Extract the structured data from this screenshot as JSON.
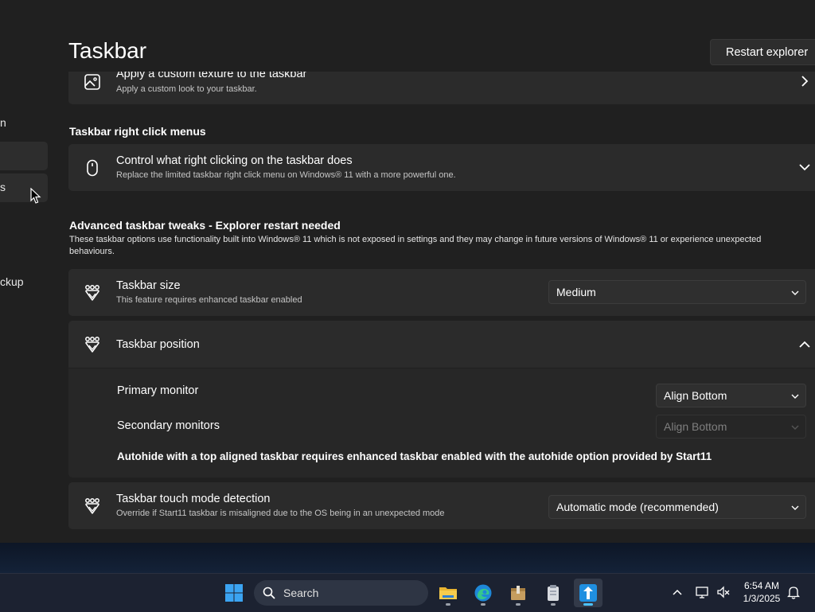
{
  "window": {
    "minimize_glyph": "—",
    "maximize_glyph": "▢"
  },
  "header": {
    "page_title": "Taskbar",
    "restart_button": "Restart explorer"
  },
  "sidebar": {
    "items": [
      {
        "label": "n"
      },
      {
        "label": ""
      },
      {
        "label": "s"
      },
      {
        "label": "ckup"
      }
    ]
  },
  "texture_card": {
    "title": "Apply a custom texture to the taskbar",
    "desc": "Apply a custom look to your taskbar."
  },
  "right_click_section": {
    "title": "Taskbar right click menus",
    "card": {
      "title": "Control what right clicking on the taskbar does",
      "desc": "Replace the limited taskbar right click menu on Windows® 11 with a more powerful one."
    }
  },
  "advanced_section": {
    "title": "Advanced taskbar tweaks - Explorer restart needed",
    "desc_line1": "These taskbar options use functionality built into Windows® 11 which is not exposed in settings and they may change in future versions of Windows® 11 or experience unexpected",
    "desc_line2": "behaviours."
  },
  "taskbar_size": {
    "title": "Taskbar size",
    "desc": "This feature requires enhanced taskbar enabled",
    "value": "Medium"
  },
  "taskbar_position": {
    "title": "Taskbar position",
    "primary_label": "Primary monitor",
    "primary_value": "Align Bottom",
    "secondary_label": "Secondary monitors",
    "secondary_value": "Align Bottom",
    "note": "Autohide with a top aligned taskbar requires enhanced taskbar enabled with the autohide option provided by Start11"
  },
  "touch_mode": {
    "title": "Taskbar touch mode detection",
    "desc": "Override if Start11 taskbar is misaligned due to the OS being in an unexpected mode",
    "value": "Automatic mode (recommended)"
  },
  "taskbar": {
    "search_placeholder": "Search",
    "time": "6:54 AM",
    "date": "1/3/2025",
    "apps": [
      "file-explorer",
      "edge",
      "package-app",
      "clipboard-app",
      "start11"
    ]
  },
  "colors": {
    "window_bg": "#202020",
    "card_bg": "#2b2b2b",
    "taskbar_bg": "#1c2231",
    "accent": "#4cc2ff"
  }
}
